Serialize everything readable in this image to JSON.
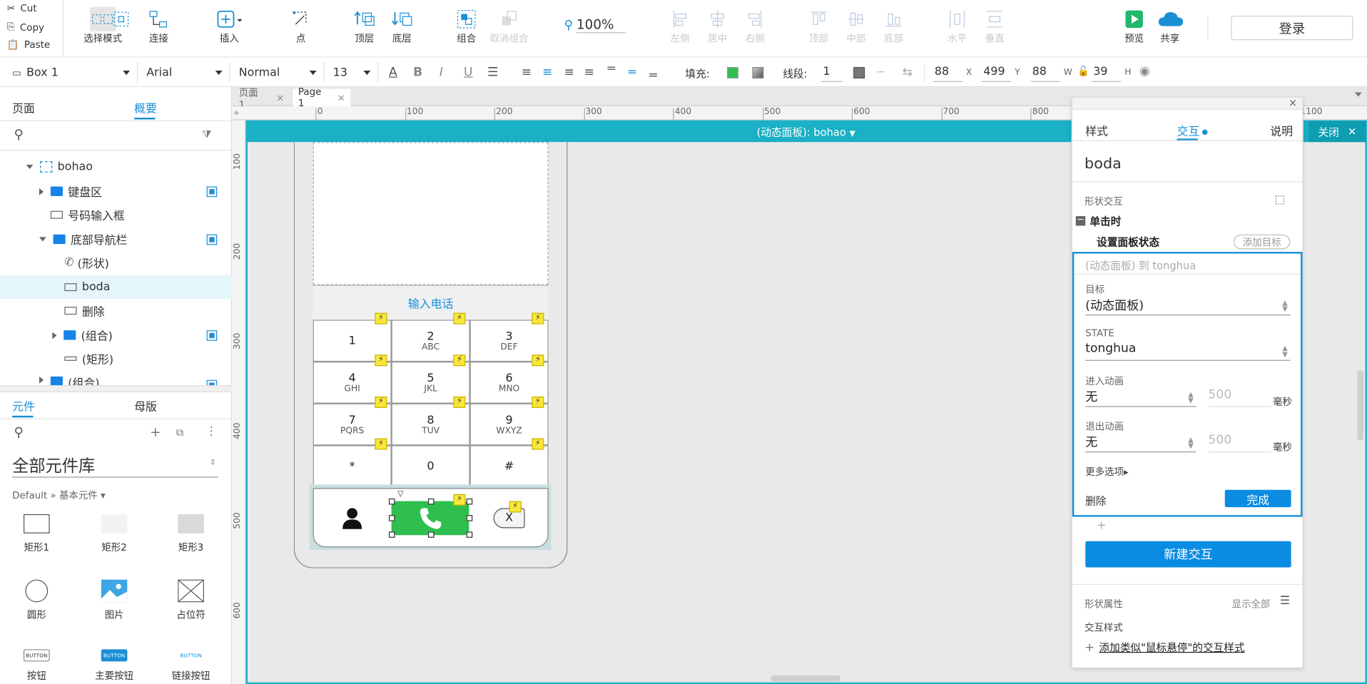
{
  "clipboard": {
    "cut": "Cut",
    "copy": "Copy",
    "paste": "Paste"
  },
  "toolbar": {
    "select_mode": "选择模式",
    "connect": "连接",
    "insert": "插入",
    "point": "点",
    "top_layer": "顶层",
    "bottom_layer": "底层",
    "group": "组合",
    "ungroup": "取消组合",
    "zoom": "100%",
    "align_left": "左侧",
    "align_center": "居中",
    "align_right": "右侧",
    "align_top": "顶部",
    "align_middle": "中部",
    "align_bottom": "底部",
    "horizontal": "水平",
    "vertical": "垂直",
    "preview": "预览",
    "share": "共享",
    "login": "登录"
  },
  "format": {
    "element_name": "Box 1",
    "font": "Arial",
    "style": "Normal",
    "size": "13",
    "fill_label": "填充:",
    "stroke_label": "线段:",
    "stroke_value": "1",
    "x": "88",
    "x_label": "X",
    "y": "499",
    "y_label": "Y",
    "w": "88",
    "w_label": "W",
    "h": "39",
    "h_label": "H",
    "fill_color": "#2ebf4f"
  },
  "left": {
    "tab_pages": "页面",
    "tab_outline": "概要",
    "tree": [
      {
        "label": "bohao"
      },
      {
        "label": "键盘区"
      },
      {
        "label": "号码输入框"
      },
      {
        "label": "底部导航栏"
      },
      {
        "label": "(形状)"
      },
      {
        "label": "boda"
      },
      {
        "label": "删除"
      },
      {
        "label": "(组合)"
      },
      {
        "label": "(矩形)"
      },
      {
        "label": "(组合)"
      }
    ],
    "tab_widgets": "元件",
    "tab_masters": "母版",
    "library_title": "全部元件库",
    "library_path": "Default » 基本元件 ▾",
    "widgets": [
      {
        "label": "矩形1"
      },
      {
        "label": "矩形2"
      },
      {
        "label": "矩形3"
      },
      {
        "label": "圆形"
      },
      {
        "label": "图片"
      },
      {
        "label": "占位符"
      },
      {
        "label": "按钮"
      },
      {
        "label": "主要按钮"
      },
      {
        "label": "链接按钮"
      }
    ],
    "button_glyph": "BUTTON"
  },
  "canvas": {
    "page_tabs": [
      {
        "label": "页面 1"
      },
      {
        "label": "Page 1"
      }
    ],
    "ruler_h": [
      "0",
      "100",
      "200",
      "300",
      "400",
      "500",
      "600",
      "700",
      "800",
      "900",
      "1000",
      "1100"
    ],
    "ruler_v": [
      "100",
      "200",
      "300",
      "400",
      "500",
      "600"
    ],
    "dynamic_panel_title": "(动态面板): bohao",
    "close_label": "关闭",
    "phone": {
      "input_label": "输入电话",
      "keys": [
        {
          "num": "1",
          "sub": ""
        },
        {
          "num": "2",
          "sub": "ABC"
        },
        {
          "num": "3",
          "sub": "DEF"
        },
        {
          "num": "4",
          "sub": "GHI"
        },
        {
          "num": "5",
          "sub": "JKL"
        },
        {
          "num": "6",
          "sub": "MNO"
        },
        {
          "num": "7",
          "sub": "PQRS"
        },
        {
          "num": "8",
          "sub": "TUV"
        },
        {
          "num": "9",
          "sub": "WXYZ"
        },
        {
          "num": "*",
          "sub": ""
        },
        {
          "num": "0",
          "sub": ""
        },
        {
          "num": "#",
          "sub": ""
        }
      ],
      "delete_label": "X",
      "bolt_glyph": "⚡",
      "call_color": "#2ebf4f"
    }
  },
  "right": {
    "tab_style": "样式",
    "tab_interaction": "交互",
    "tab_notes": "说明",
    "element_name": "boda",
    "section_shape_interaction": "形状交互",
    "event": "单击时",
    "action": "设置面板状态",
    "add_target": "添加目标",
    "action_summary": "(动态面板) 到 tonghua",
    "target_label": "目标",
    "target_value": "(动态面板)",
    "state_label": "STATE",
    "state_value": "tonghua",
    "enter_anim_label": "进入动画",
    "enter_anim_value": "无",
    "enter_ms": "500",
    "exit_anim_label": "退出动画",
    "exit_anim_value": "无",
    "exit_ms": "500",
    "ms_unit": "毫秒",
    "more_options": "更多选项▸",
    "delete": "删除",
    "done": "完成",
    "plus": "+",
    "new_interaction": "新建交互",
    "shape_props": "形状属性",
    "show_all": "显示全部",
    "interaction_style": "交互样式",
    "add_style": "添加类似\"鼠标悬停\"的交互样式"
  }
}
